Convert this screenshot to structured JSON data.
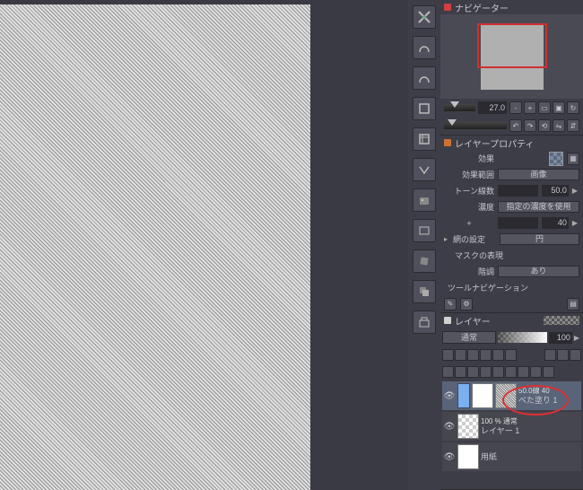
{
  "navigator": {
    "title": "ナビゲーター",
    "zoom_value": "27.0"
  },
  "layer_property": {
    "title": "レイヤープロパティ",
    "effect_label": "効果",
    "effect_range_label": "効果範囲",
    "effect_range_value": "画像",
    "tone_lines_label": "トーン線数",
    "tone_lines_value": "50.0",
    "density_label": "濃度",
    "density_value_text": "指定の濃度を使用",
    "density_plus_label": "+",
    "density_plus_value": "40",
    "dot_settings_label": "網の設定",
    "dot_settings_value": "円",
    "mask_expression": "マスクの表現",
    "gradation_label": "階調",
    "gradation_value": "あり",
    "tool_navigation": "ツールナビゲーション"
  },
  "layers": {
    "title": "レイヤー",
    "blend_mode": "通常",
    "opacity": "100",
    "items": [
      {
        "info": "50.0線 40",
        "name": "べた塗り 1"
      },
      {
        "info": "100 % 通常",
        "name": "レイヤー 1"
      },
      {
        "info": "",
        "name": "用紙"
      }
    ]
  }
}
